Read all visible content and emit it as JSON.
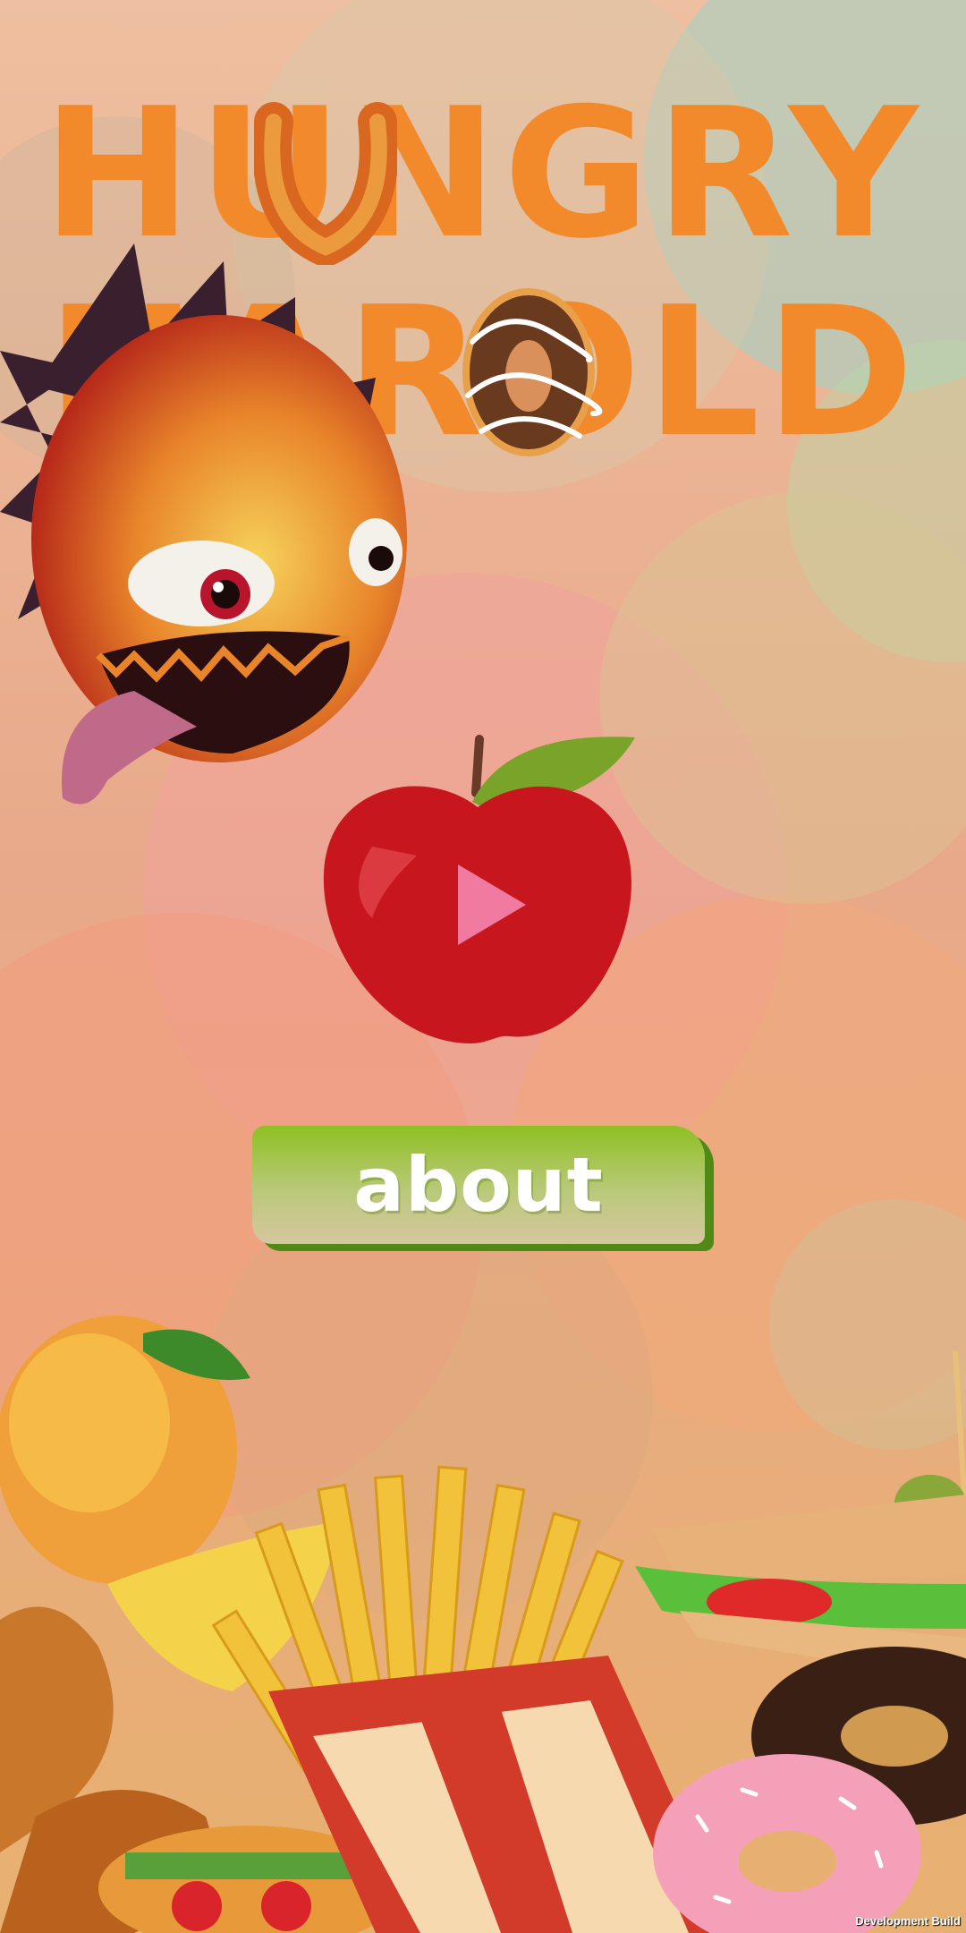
{
  "title": {
    "line1": "HUNGRY",
    "line2": "HAROLD"
  },
  "menu": {
    "play_icon": "play-icon",
    "about_label": "about"
  },
  "footer": {
    "build_label": "Development Build"
  },
  "icons": {
    "title_u": "snack-ring-icon",
    "title_o": "donut-icon",
    "play": "apple-play-icon",
    "mascot": "harold-monster",
    "food": [
      "mango-icon",
      "chicken-icon",
      "fries-icon",
      "sandwich-icon",
      "donut-icon",
      "burger-icon"
    ]
  },
  "colors": {
    "title_orange": "#f28a2b",
    "apple_red": "#c8161e",
    "leaf_green": "#7aa32a",
    "button_green": "#8fbf23",
    "play_pink": "#f07aa0"
  }
}
